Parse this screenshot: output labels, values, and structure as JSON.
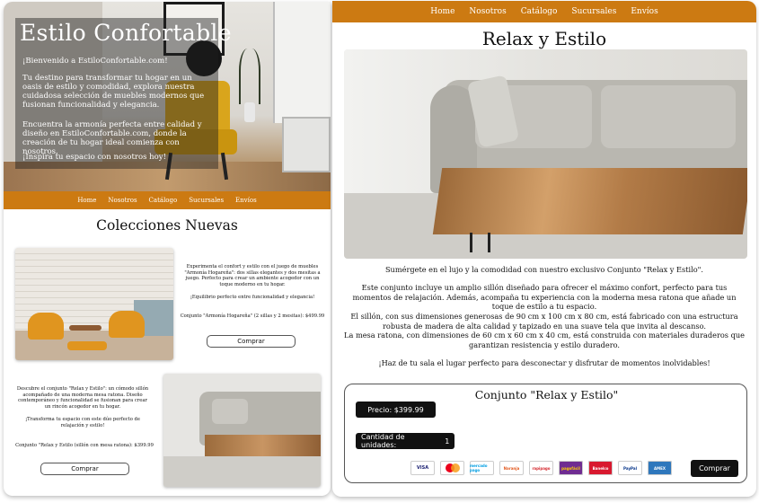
{
  "colors": {
    "nav_bg": "#cc7a12",
    "button_dark": "#111111"
  },
  "left": {
    "hero": {
      "site_title": "Estilo Confortable",
      "welcome": "¡Bienvenido a EstiloConfortable.com!",
      "intro": "Tu destino para transformar tu hogar en un oasis de estilo y comodidad, explora nuestra cuidadosa selección de muebles modernos que fusionan funcionalidad y elegancia.",
      "harmony": " Encuentra la armonía perfecta entre calidad y diseño en EstiloConfortable.com, donde la creación de tu hogar ideal comienza con nosotros.",
      "inspire": "¡Inspira tu espacio con nosotros hoy!"
    },
    "nav": [
      "Home",
      "Nosotros",
      "Catálogo",
      "Sucursales",
      "Envíos"
    ],
    "section_title": "Colecciones Nuevas",
    "products": [
      {
        "desc": "Experimenta el confort y estilo con el juego de muebles \"Armonía Hogareña\": dos sillas elegantes y dos mesitas a juego. Perfecto para crear un ambiente acogedor con un toque moderno en tu hogar.",
        "tagline": "¡Equilibrio perfecto entre funcionalidad y elegancia!",
        "price_line": "Conjunto \"Armonía Hogareña\" (2 sillas y 2 mesitas): $499.99",
        "button": "Comprar",
        "image_icon": "living-room-chairs-image"
      },
      {
        "desc": "Descubre el conjunto \"Relax y Estilo\": un cómodo sillón acompañado de una moderna mesa ratona. Diseño contemporáneo y funcionalidad se fusionan para crear un rincón acogedor en tu hogar.",
        "tagline": "¡Transforma tu espacio con este dúo perfecto de relajación y estilo!",
        "price_line": "Conjunto \"Relax y Estilo (sillón con mesa ratona): $399.99",
        "button": "Comprar",
        "image_icon": "sofa-table-image"
      }
    ]
  },
  "right": {
    "nav": [
      "Home",
      "Nosotros",
      "Catálogo",
      "Sucursales",
      "Envíos"
    ],
    "title": "Relax y Estilo",
    "paragraphs": [
      "Sumérgete en el lujo y la comodidad con nuestro exclusivo Conjunto \"Relax y Estilo\".",
      "Este conjunto incluye un amplio sillón diseñado para ofrecer el máximo confort, perfecto para tus momentos de relajación. Además, acompaña tu experiencia con  la moderna mesa ratona que añade un toque de estilo a tu espacio.",
      "El sillón, con sus dimensiones generosas de 90 cm x 100 cm x 80 cm, está fabricado con una estructura robusta de madera de alta calidad y tapizado en una suave tela que invita al descanso.\nLa mesa ratona, con dimensiones de 60 cm x 60 cm x 40 cm, está construida con materiales duraderos que garantizan resistencia y estilo duradero.",
      "¡Haz de tu sala el lugar perfecto para desconectar y disfrutar de momentos inolvidables!"
    ],
    "buy_box": {
      "title": "Conjunto \"Relax y Estilo\"",
      "price": "Precio: $399.99",
      "qty_label": "Cantidad de unidades:",
      "qty_value": "1",
      "button": "Comprar",
      "payment_methods": [
        "VISA",
        "Mastercard",
        "mercado pago",
        "Naranja",
        "rapipago",
        "pagofácil",
        "Banelco",
        "PayPal",
        "AMEX"
      ]
    }
  }
}
